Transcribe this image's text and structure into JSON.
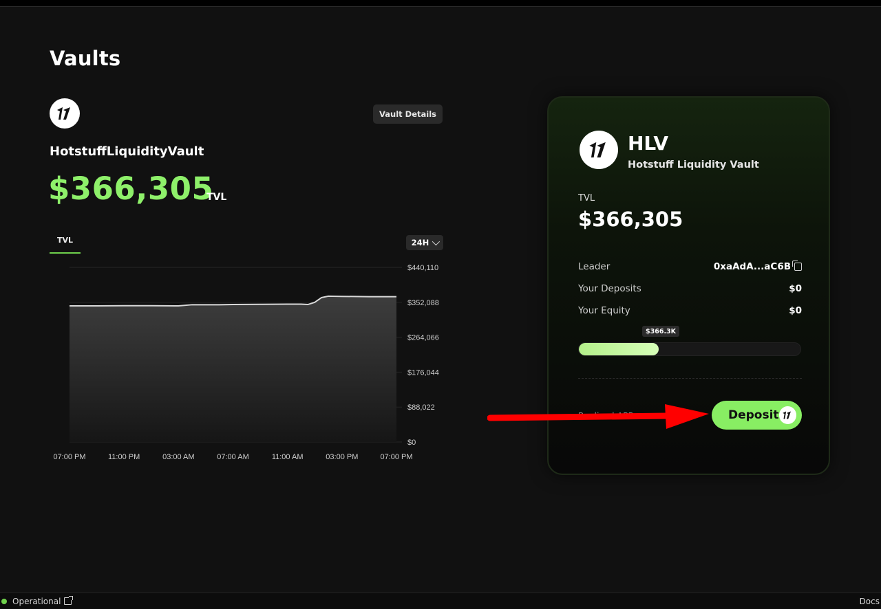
{
  "page": {
    "title": "Vaults"
  },
  "vault": {
    "details_button": "Vault Details",
    "name": "HotstuffLiquidityVault",
    "tvl_value": "$366,305",
    "tvl_suffix": "TVL"
  },
  "chart_controls": {
    "tab_label": "TVL",
    "range_label": "24H"
  },
  "chart_data": {
    "type": "area",
    "title": "",
    "xlabel": "",
    "ylabel": "",
    "y_tick_labels": [
      "$440,110",
      "$352,088",
      "$264,066",
      "$176,044",
      "$88,022",
      "$0"
    ],
    "y_ticks": [
      440110,
      352088,
      264066,
      176044,
      88022,
      0
    ],
    "ylim": [
      0,
      440110
    ],
    "x_tick_labels": [
      "07:00 PM",
      "11:00 PM",
      "03:00 AM",
      "07:00 AM",
      "11:00 AM",
      "03:00 PM",
      "07:00 PM"
    ],
    "xlim": [
      0,
      24
    ],
    "grid": true,
    "series": [
      {
        "x": [
          0,
          2,
          4,
          6,
          8,
          9,
          10,
          11,
          12,
          14,
          16,
          17,
          17.5,
          18,
          18.5,
          19,
          20,
          22,
          24
        ],
        "y": [
          343000,
          343000,
          343500,
          343500,
          343000,
          346000,
          346000,
          346000,
          346500,
          347000,
          347500,
          347500,
          346500,
          352000,
          364000,
          367500,
          367000,
          366300,
          366305
        ]
      }
    ],
    "line_color": "#d9d9d9"
  },
  "card": {
    "symbol": "HLV",
    "full_name": "Hotstuff Liquidity Vault",
    "tvl_label": "TVL",
    "tvl_value": "$366,305",
    "rows": [
      {
        "label": "Leader",
        "value": "0xaAdA...aC6B"
      },
      {
        "label": "Your Deposits",
        "value": "$0"
      },
      {
        "label": "Your Equity",
        "value": "$0"
      }
    ],
    "capacity_tooltip": "$366.3K",
    "capacity_fill_fraction": 0.36,
    "apr_label": "Realized APR",
    "deposit_label": "Deposit"
  },
  "status_bar": {
    "status": "Operational",
    "status_color": "#6fd14c",
    "docs_label": "Docs"
  },
  "colors": {
    "accent_green": "#88ee63",
    "tvl_green": "#8ef06a",
    "arrow_red": "#ff0000"
  }
}
